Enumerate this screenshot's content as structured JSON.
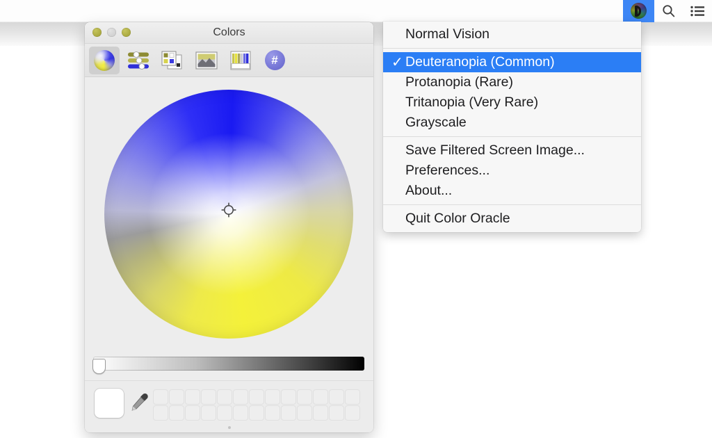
{
  "menubar": {
    "status_items": [
      {
        "name": "color-oracle",
        "icon": "color-oracle-d-icon",
        "active": true
      },
      {
        "name": "spotlight",
        "icon": "search-icon",
        "active": false
      },
      {
        "name": "notification-center",
        "icon": "list-icon",
        "active": false
      }
    ],
    "highlight_color": "#2b7ef5"
  },
  "menu": {
    "items": [
      {
        "label": "Normal Vision",
        "checked": false,
        "selected": false,
        "separator_after": true
      },
      {
        "label": "Deuteranopia (Common)",
        "checked": true,
        "selected": true,
        "separator_after": false
      },
      {
        "label": "Protanopia (Rare)",
        "checked": false,
        "selected": false,
        "separator_after": false
      },
      {
        "label": "Tritanopia (Very Rare)",
        "checked": false,
        "selected": false,
        "separator_after": false
      },
      {
        "label": "Grayscale",
        "checked": false,
        "selected": false,
        "separator_after": true
      },
      {
        "label": "Save Filtered Screen Image...",
        "checked": false,
        "selected": false,
        "separator_after": false
      },
      {
        "label": "Preferences...",
        "checked": false,
        "selected": false,
        "separator_after": false
      },
      {
        "label": "About...",
        "checked": false,
        "selected": false,
        "separator_after": true
      },
      {
        "label": "Quit Color Oracle",
        "checked": false,
        "selected": false,
        "separator_after": false
      }
    ],
    "checkmark_glyph": "✓"
  },
  "colors_window": {
    "title": "Colors",
    "traffic_lights": [
      {
        "name": "close",
        "color": "#9d9c33"
      },
      {
        "name": "minimize",
        "color": "#c9c9c9"
      },
      {
        "name": "zoom",
        "color": "#9d9c33"
      }
    ],
    "toolbar": [
      {
        "name": "color-wheel",
        "label": "Color Wheel",
        "selected": true
      },
      {
        "name": "color-sliders",
        "label": "Color Sliders",
        "selected": false
      },
      {
        "name": "color-palettes",
        "label": "Color Palettes",
        "selected": false
      },
      {
        "name": "image-palettes",
        "label": "Image Palettes",
        "selected": false
      },
      {
        "name": "pencils",
        "label": "Pencils",
        "selected": false
      },
      {
        "name": "hash",
        "label": "#",
        "selected": false
      }
    ],
    "hash_label": "#",
    "brightness_slider": {
      "name": "opacity-slider",
      "value_position_pct": 1
    },
    "palette_rows": 2,
    "palette_columns": 13,
    "current_color": "#ffffff"
  }
}
